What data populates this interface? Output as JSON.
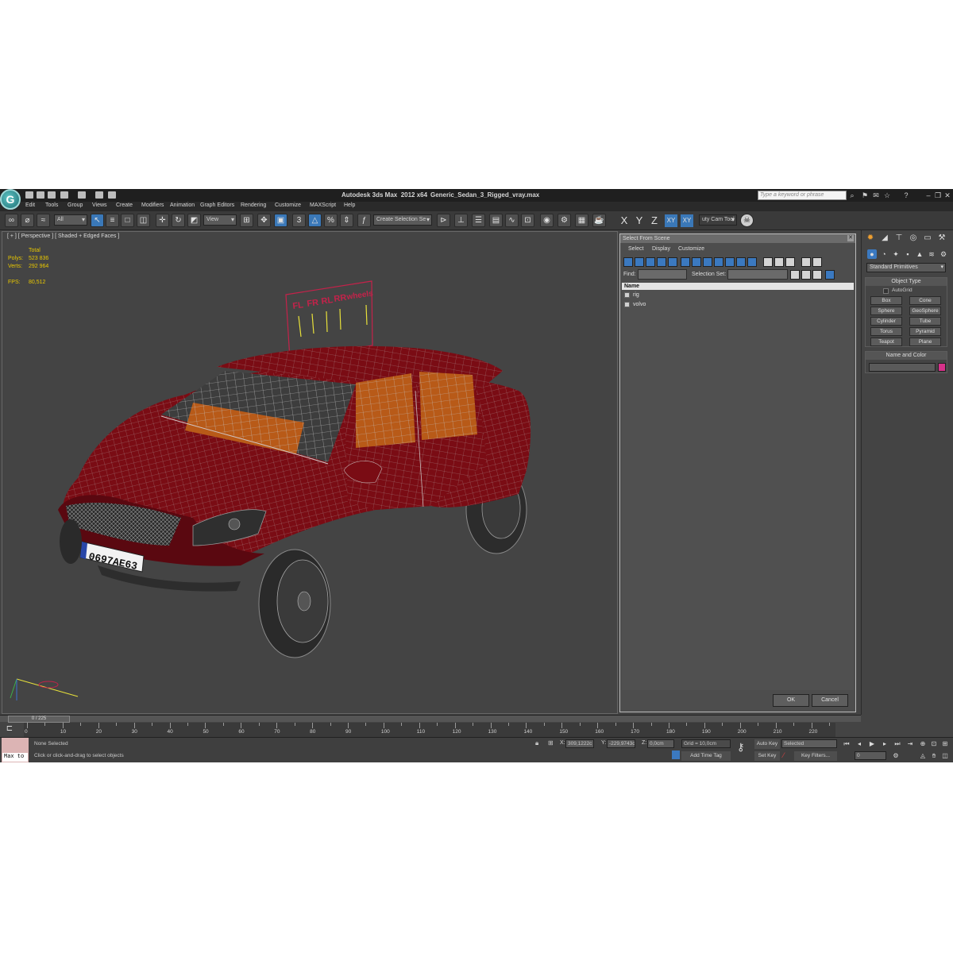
{
  "app": {
    "logo_letter": "G",
    "title": "Autodesk 3ds Max  2012 x64",
    "file": "Generic_Sedan_3_Rigged_vray.max",
    "search_placeholder": "Type a keyword or phrase"
  },
  "menu": [
    "Edit",
    "Tools",
    "Group",
    "Views",
    "Create",
    "Modifiers",
    "Animation",
    "Graph Editors",
    "Rendering",
    "Customize",
    "MAXScript",
    "Help"
  ],
  "toolbar": {
    "filter_value": "All",
    "refcoord_value": "View",
    "selection_set_placeholder": "Create Selection Se",
    "axes": [
      "X",
      "Y",
      "Z",
      "XY",
      "XY"
    ],
    "util_label": "uty Cam Tool"
  },
  "viewport": {
    "label": "[ + ] [ Perspective ] [ Shaded + Edged Faces ]",
    "stats": {
      "total_label": "Total",
      "polys_label": "Polys:",
      "polys_value": "523 836",
      "verts_label": "Verts:",
      "verts_value": "292 964",
      "fps_label": "FPS:",
      "fps_value": "80,512"
    },
    "rig_labels": [
      "FL",
      "FR",
      "RL",
      "RR",
      "wheels"
    ],
    "plate": "0697AE63",
    "model_color": "#7a0c14",
    "interior_color": "#b85a18",
    "helper_color": "#c4224a"
  },
  "dialog": {
    "title": "Select From Scene",
    "menus": [
      "Select",
      "Display",
      "Customize"
    ],
    "find_label": "Find:",
    "selection_set_label": "Selection Set:",
    "column": "Name",
    "rows": [
      "rig",
      "volvo"
    ],
    "ok": "OK",
    "cancel": "Cancel"
  },
  "command_panel": {
    "category": "Standard Primitives",
    "object_type_title": "Object Type",
    "autogrid_label": "AutoGrid",
    "primitives": [
      "Box",
      "Cone",
      "Sphere",
      "GeoSphere",
      "Cylinder",
      "Tube",
      "Torus",
      "Pyramid",
      "Teapot",
      "Plane"
    ],
    "name_color_title": "Name and Color",
    "object_color": "#d6318a"
  },
  "timeline": {
    "frame_display": "0 / 225",
    "ticks": [
      0,
      10,
      20,
      30,
      40,
      50,
      60,
      70,
      80,
      90,
      100,
      110,
      120,
      130,
      140,
      150,
      160,
      170,
      180,
      190,
      200,
      210,
      220
    ]
  },
  "status": {
    "maxscript_text": "Max to",
    "selection_text": "None Selected",
    "prompt_text": "Click or click-and-drag to select objects",
    "x_label": "X:",
    "x_value": "309,1222c",
    "y_label": "Y:",
    "y_value": "-229,9743c",
    "z_label": "Z:",
    "z_value": "0,0cm",
    "grid_text": "Grid = 10,0cm",
    "add_time_tag": "Add Time Tag",
    "auto_key": "Auto Key",
    "auto_key_value": "Selected",
    "set_key": "Set Key",
    "key_filters": "Key Filters...",
    "frame_value": "0"
  }
}
